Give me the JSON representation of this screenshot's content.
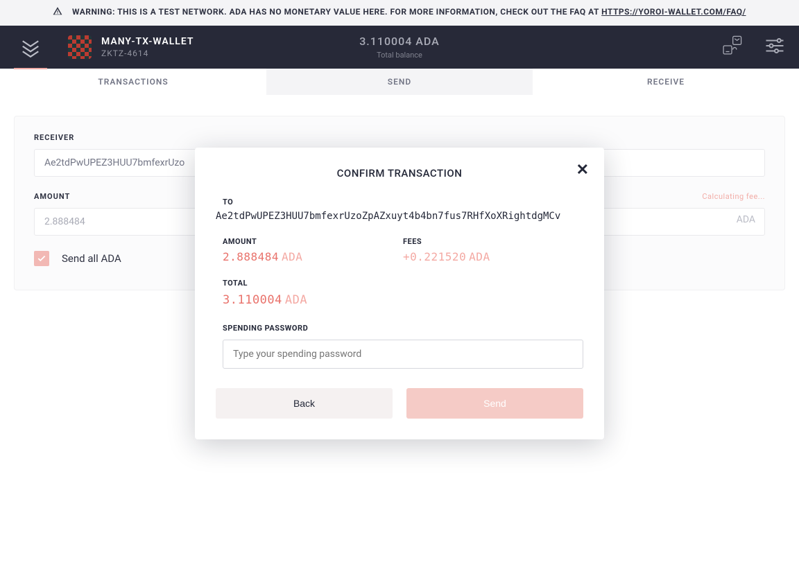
{
  "warning": {
    "prefix": "WARNING: THIS IS A TEST NETWORK. ADA HAS NO MONETARY VALUE HERE. FOR MORE INFORMATION, CHECK OUT THE FAQ AT ",
    "link": "HTTPS://YOROI-WALLET.COM/FAQ/"
  },
  "header": {
    "wallet_name": "MANY-TX-WALLET",
    "wallet_sub": "ZKTZ-4614",
    "balance_value": "3.110004 ADA",
    "balance_label": "Total balance"
  },
  "tabs": {
    "transactions": "TRANSACTIONS",
    "send": "SEND",
    "receive": "RECEIVE"
  },
  "form": {
    "receiver_label": "RECEIVER",
    "receiver_value": "Ae2tdPwUPEZ3HUU7bmfexrUzo",
    "amount_label": "AMOUNT",
    "amount_value": "2.888484",
    "amount_unit": "ADA",
    "fee_status": "Calculating fee...",
    "send_all_label": "Send all ADA"
  },
  "modal": {
    "title": "CONFIRM TRANSACTION",
    "to_label": "TO",
    "to_address": "Ae2tdPwUPEZ3HUU7bmfexrUzoZpAZxuyt4b4bn7fus7RHfXoXRightdgMCv",
    "amount_label": "AMOUNT",
    "amount_value": "2.888484",
    "amount_unit": "ADA",
    "fees_label": "FEES",
    "fees_value": "+0.221520",
    "fees_unit": "ADA",
    "total_label": "TOTAL",
    "total_value": "3.110004",
    "total_unit": "ADA",
    "pw_label": "SPENDING PASSWORD",
    "pw_placeholder": "Type your spending password",
    "back": "Back",
    "send": "Send"
  }
}
